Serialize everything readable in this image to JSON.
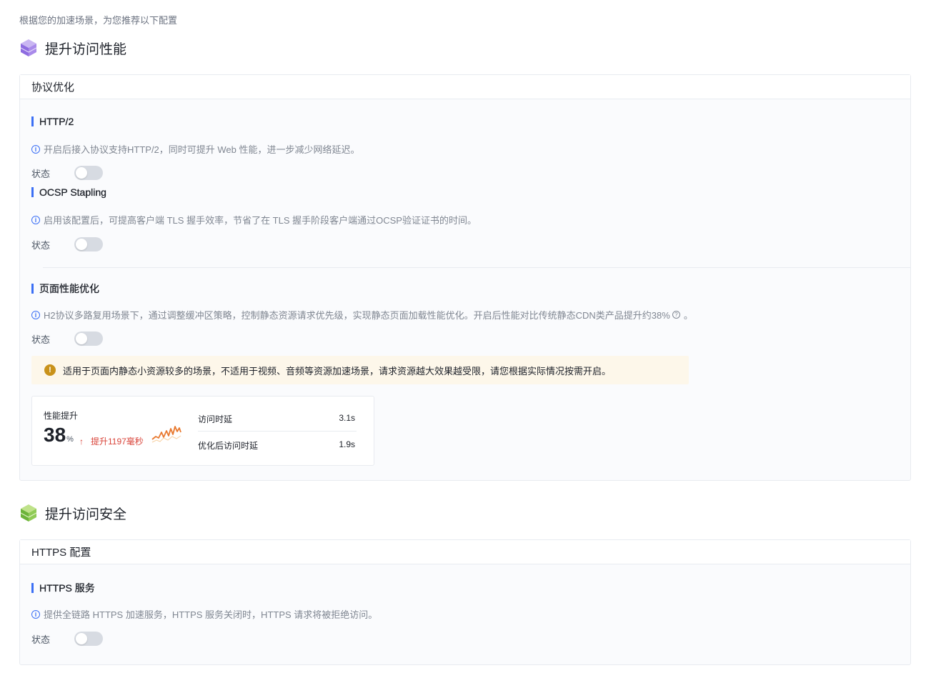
{
  "intro": "根据您的加速场景，为您推荐以下配置",
  "sections": [
    {
      "title": "提升访问性能",
      "icon": "purple-cube-icon",
      "card_title": "协议优化",
      "items": [
        {
          "title": "HTTP/2",
          "desc": "开启后接入协议支持HTTP/2，同时可提升 Web 性能，进一步减少网络延迟。",
          "status_label": "状态",
          "enabled": false
        },
        {
          "title": "OCSP Stapling",
          "desc": "启用该配置后，可提高客户端 TLS 握手效率，节省了在 TLS 握手阶段客户端通过OCSP验证证书的时间。",
          "status_label": "状态",
          "enabled": false
        },
        {
          "title": "页面性能优化",
          "desc": "H2协议多路复用场景下，通过调整缓冲区策略，控制静态资源请求优先级，实现静态页面加载性能优化。开启后性能对比传统静态CDN类产品提升约38%",
          "desc_suffix": "。",
          "status_label": "状态",
          "enabled": false
        }
      ],
      "warning": "适用于页面内静态小资源较多的场景，不适用于视频、音频等资源加速场景，请求资源越大效果越受限，请您根据实际情况按需开启。",
      "perf": {
        "label": "性能提升",
        "value": "38",
        "unit": "%",
        "gain": "提升1197毫秒",
        "rows": [
          {
            "label": "访问时延",
            "value": "3.1s"
          },
          {
            "label": "优化后访问时延",
            "value": "1.9s"
          }
        ]
      }
    },
    {
      "title": "提升访问安全",
      "icon": "green-cube-icon",
      "card_title": "HTTPS 配置",
      "items": [
        {
          "title": "HTTPS 服务",
          "desc": "提供全链路 HTTPS 加速服务，HTTPS 服务关闭时，HTTPS 请求将被拒绝访问。",
          "status_label": "状态",
          "enabled": false
        }
      ]
    }
  ],
  "colors": {
    "accent": "#3b6ff5",
    "warning": "#c9921a",
    "gain": "#d9453b"
  }
}
